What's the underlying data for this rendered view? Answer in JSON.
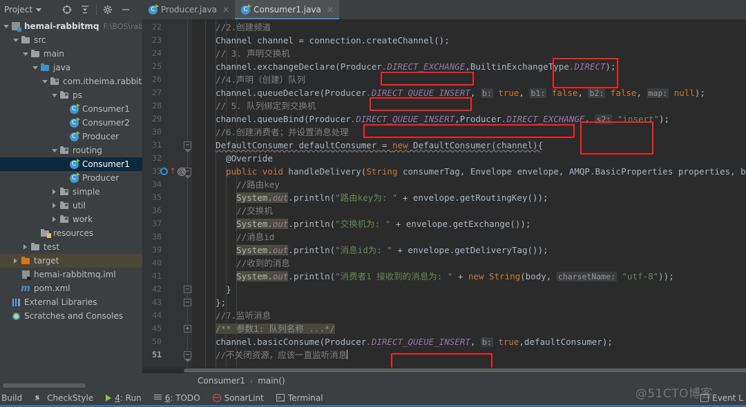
{
  "window": {
    "project_panel_label": "Project",
    "toolbar_icons": [
      "locate-icon",
      "collapse-all-icon",
      "settings-icon",
      "minimize-icon"
    ]
  },
  "tabs": [
    {
      "label": "Producer.java",
      "active": false,
      "icon": "java-class-icon",
      "close": "×"
    },
    {
      "label": "Consumer1.java",
      "active": true,
      "icon": "java-class-icon",
      "close": "×"
    }
  ],
  "sidebar": {
    "items": [
      {
        "label": "hemai-rabbitmq",
        "path": "F:\\BOS\\rabbitM",
        "indent": 0,
        "arrow": "expanded",
        "icon": "module-icon",
        "bold": true,
        "state": "normal"
      },
      {
        "label": "src",
        "indent": 1,
        "arrow": "expanded",
        "icon": "folder-gray",
        "state": "normal"
      },
      {
        "label": "main",
        "indent": 2,
        "arrow": "expanded",
        "icon": "folder-gray",
        "state": "normal"
      },
      {
        "label": "java",
        "indent": 3,
        "arrow": "expanded",
        "icon": "folder-blue",
        "state": "normal"
      },
      {
        "label": "com.itheima.rabbitmq",
        "indent": 4,
        "arrow": "expanded",
        "icon": "folder-package",
        "state": "normal"
      },
      {
        "label": "ps",
        "indent": 5,
        "arrow": "expanded",
        "icon": "folder-package",
        "state": "normal"
      },
      {
        "label": "Consumer1",
        "indent": 6,
        "arrow": "none",
        "icon": "java-class-icon",
        "state": "normal"
      },
      {
        "label": "Consumer2",
        "indent": 6,
        "arrow": "none",
        "icon": "java-class-icon",
        "state": "normal"
      },
      {
        "label": "Producer",
        "indent": 6,
        "arrow": "none",
        "icon": "java-class-icon",
        "state": "normal"
      },
      {
        "label": "routing",
        "indent": 5,
        "arrow": "expanded",
        "icon": "folder-package",
        "state": "normal"
      },
      {
        "label": "Consumer1",
        "indent": 6,
        "arrow": "none",
        "icon": "java-class-icon",
        "state": "selected"
      },
      {
        "label": "Producer",
        "indent": 6,
        "arrow": "none",
        "icon": "java-class-icon",
        "state": "normal"
      },
      {
        "label": "simple",
        "indent": 5,
        "arrow": "collapsed",
        "icon": "folder-package",
        "state": "normal"
      },
      {
        "label": "util",
        "indent": 5,
        "arrow": "collapsed",
        "icon": "folder-package",
        "state": "normal"
      },
      {
        "label": "work",
        "indent": 5,
        "arrow": "collapsed",
        "icon": "folder-package",
        "state": "normal"
      },
      {
        "label": "resources",
        "indent": 3,
        "arrow": "none",
        "icon": "folder-resources",
        "state": "normal"
      },
      {
        "label": "test",
        "indent": 2,
        "arrow": "collapsed",
        "icon": "folder-gray",
        "state": "normal"
      },
      {
        "label": "target",
        "indent": 1,
        "arrow": "collapsed",
        "icon": "folder-orange",
        "state": "highlight"
      },
      {
        "label": "hemai-rabbitmq.iml",
        "indent": 1,
        "arrow": "none",
        "icon": "iml-icon",
        "state": "normal"
      },
      {
        "label": "pom.xml",
        "indent": 1,
        "arrow": "none",
        "icon": "maven-icon",
        "state": "normal"
      },
      {
        "label": "External Libraries",
        "indent": 0,
        "arrow": "none",
        "icon": "library-icon",
        "state": "normal"
      },
      {
        "label": "Scratches and Consoles",
        "indent": 0,
        "arrow": "none",
        "icon": "scratches-icon",
        "state": "normal"
      }
    ]
  },
  "editor": {
    "line_numbers": [
      "22",
      "23",
      "24",
      "25",
      "26",
      "27",
      "28",
      "29",
      "30",
      "31",
      "32",
      "33",
      "34",
      "35",
      "36",
      "37",
      "38",
      "39",
      "40",
      "41",
      "42",
      "43",
      "44",
      "45",
      "50",
      "51"
    ],
    "current_line": "51",
    "fold_markers": [
      {
        "line": "31",
        "type": "end"
      },
      {
        "line": "33",
        "type": "end"
      },
      {
        "line": "42",
        "type": "minus"
      },
      {
        "line": "43",
        "type": "minus"
      },
      {
        "line": "45",
        "type": "plus"
      },
      {
        "line": "51",
        "type": "end"
      }
    ],
    "gutter_icons": {
      "line": "33",
      "icons": [
        "implementing-method-icon",
        "override-annotation-icon"
      ]
    },
    "code_lines": [
      {
        "n": "22",
        "indent": 2,
        "text": "//2.创建频道",
        "kind": "comment"
      },
      {
        "n": "23",
        "indent": 2,
        "text": "Channel channel = connection.createChannel();"
      },
      {
        "n": "24",
        "indent": 2,
        "text": "// 3. 声明交换机",
        "kind": "comment"
      },
      {
        "n": "25",
        "indent": 2,
        "text": "channel.exchangeDeclare(Producer.DIRECT_EXCHANGE,BuiltinExchangeType.DIRECT);"
      },
      {
        "n": "26",
        "indent": 2,
        "text": "//4.声明（创建）队列",
        "kind": "comment"
      },
      {
        "n": "27",
        "indent": 2,
        "text": "channel.queueDeclare(Producer.DIRECT_QUEUE_INSERT, b: true, b1: false, b2: false, map: null);"
      },
      {
        "n": "28",
        "indent": 2,
        "text": "// 5. 队列绑定到交换机",
        "kind": "comment"
      },
      {
        "n": "29",
        "indent": 2,
        "text": "channel.queueBind(Producer.DIRECT_QUEUE_INSERT,Producer.DIRECT_EXCHANGE, s2: \"insert\");"
      },
      {
        "n": "30",
        "indent": 2,
        "text": "//6.创建消费者；并设置消息处理",
        "kind": "comment"
      },
      {
        "n": "31",
        "indent": 2,
        "text": "DefaultConsumer defaultConsumer = new DefaultConsumer(channel){"
      },
      {
        "n": "32",
        "indent": 3,
        "text": "@Override"
      },
      {
        "n": "33",
        "indent": 3,
        "text": "public void handleDelivery(String consumerTag, Envelope envelope, AMQP.BasicProperties properties, byte"
      },
      {
        "n": "34",
        "indent": 4,
        "text": "//路由key",
        "kind": "comment"
      },
      {
        "n": "35",
        "indent": 4,
        "text": "System.out.println(\"路由key为: \" + envelope.getRoutingKey());"
      },
      {
        "n": "36",
        "indent": 4,
        "text": "//交换机",
        "kind": "comment"
      },
      {
        "n": "37",
        "indent": 4,
        "text": "System.out.println(\"交换机为: \" + envelope.getExchange());"
      },
      {
        "n": "38",
        "indent": 4,
        "text": "//消息id",
        "kind": "comment"
      },
      {
        "n": "39",
        "indent": 4,
        "text": "System.out.println(\"消息id为: \" + envelope.getDeliveryTag());"
      },
      {
        "n": "40",
        "indent": 4,
        "text": "//收到的消息",
        "kind": "comment"
      },
      {
        "n": "41",
        "indent": 4,
        "text": "System.out.println(\"消费者1 接收到的消息为: \" + new String(body, charsetName: \"utf-8\"));"
      },
      {
        "n": "42",
        "indent": 3,
        "text": "}"
      },
      {
        "n": "43",
        "indent": 2,
        "text": "};"
      },
      {
        "n": "44",
        "indent": 2,
        "text": "//7.监听消息",
        "kind": "comment"
      },
      {
        "n": "45",
        "indent": 2,
        "text": "/** 参数1: 队列名称 ...*/",
        "kind": "doc"
      },
      {
        "n": "50",
        "indent": 2,
        "text": "channel.basicConsume(Producer.DIRECT_QUEUE_INSERT, b: true,defaultConsumer);"
      },
      {
        "n": "51",
        "indent": 2,
        "text": "//不关闭资源，应该一直监听消息",
        "kind": "comment"
      }
    ],
    "annotations": [
      {
        "name": "direct-exchange-box",
        "label": "Producer.DIRECT_EXCHANGE",
        "color": "#ff2222"
      },
      {
        "name": "builtin-direct-box",
        "label": "BuiltinExchangeType.DIRECT",
        "color": "#ff2222"
      },
      {
        "name": "queue-declare-box",
        "label": "Producer.DIRECT_QUEUE_INSERT",
        "color": "#ff2222"
      },
      {
        "name": "queue-bind-queue-box",
        "label": "Producer.DIRECT_QUEUE_INSERT",
        "color": "#ff2222"
      },
      {
        "name": "queue-bind-exchange-box",
        "label": "Producer.DIRECT_EXCHANGE",
        "color": "#ff2222"
      },
      {
        "name": "routing-key-insert-box",
        "label": "\"insert\"",
        "color": "#ff2222"
      },
      {
        "name": "basic-consume-queue-box",
        "label": "Producer.DIRECT_QUEUE_INSERT",
        "color": "#ff2222"
      }
    ]
  },
  "breadcrumb": {
    "class": "Consumer1",
    "separator": "›",
    "method": "main()"
  },
  "statusbar": {
    "items": [
      {
        "label": "Build",
        "icon": "build-icon"
      },
      {
        "label": "CheckStyle",
        "icon": "checkstyle-icon"
      },
      {
        "label": "4: Run",
        "mnemonic": "4",
        "icon": "run-icon"
      },
      {
        "label": "6: TODO",
        "mnemonic": "6",
        "icon": "todo-icon"
      },
      {
        "label": "SonarLint",
        "icon": "sonarlint-icon"
      },
      {
        "label": "Terminal",
        "icon": "terminal-icon"
      }
    ],
    "event_log": "Event L",
    "watermark": "@51CTO博客"
  }
}
